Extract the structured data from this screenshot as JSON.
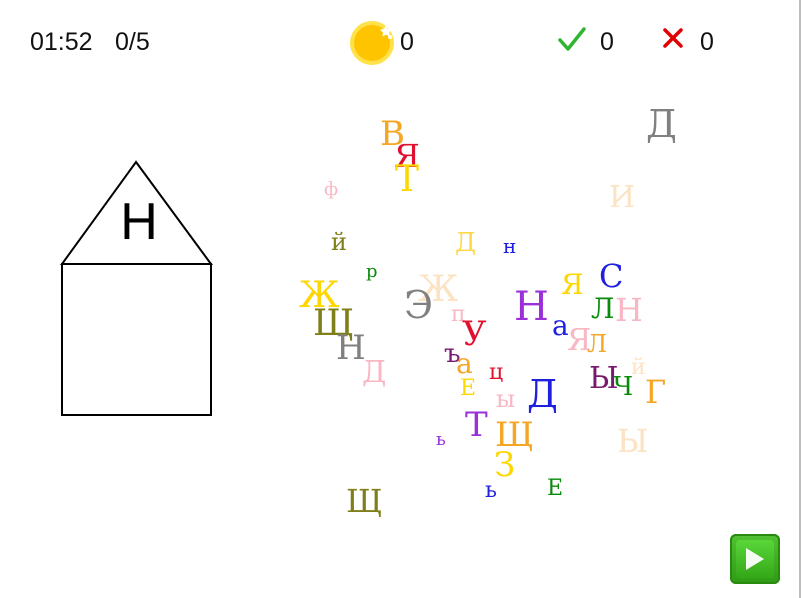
{
  "hud": {
    "timer": "01:52",
    "progress": "0/5",
    "coins": "0",
    "correct": "0",
    "wrong": "0",
    "icons": {
      "coin": "coin-star-icon",
      "correct": "checkmark-icon",
      "wrong": "cross-icon",
      "play": "play-icon"
    },
    "colors": {
      "coin": "#ffcc00",
      "correct": "#2fb52f",
      "wrong": "#e00000",
      "play": "#3fae1f"
    }
  },
  "house": {
    "letter": "Н"
  },
  "letters": [
    {
      "char": "В",
      "color": "#f5a623"
    },
    {
      "char": "Я",
      "color": "#e0102e"
    },
    {
      "char": "Т",
      "color": "#ffd700"
    },
    {
      "char": "Д",
      "color": "#808080"
    },
    {
      "char": "ф",
      "color": "#f8b7c3"
    },
    {
      "char": "И",
      "color": "#fbe3c4"
    },
    {
      "char": "й",
      "color": "#7f7f1a"
    },
    {
      "char": "Д",
      "color": "#ffd84a"
    },
    {
      "char": "н",
      "color": "#1f1fe0"
    },
    {
      "char": "р",
      "color": "#0a8a0a"
    },
    {
      "char": "Я",
      "color": "#ffd700"
    },
    {
      "char": "С",
      "color": "#1f1fe0"
    },
    {
      "char": "Ж",
      "color": "#ffd700"
    },
    {
      "char": "Ж",
      "color": "#fbe3c4"
    },
    {
      "char": "Э",
      "color": "#808080"
    },
    {
      "char": "Н",
      "color": "#9b30d9"
    },
    {
      "char": "Л",
      "color": "#0a8a0a"
    },
    {
      "char": "Н",
      "color": "#f8b7c3"
    },
    {
      "char": "Щ",
      "color": "#7f7f1a"
    },
    {
      "char": "п",
      "color": "#f8b7c3"
    },
    {
      "char": "У",
      "color": "#e0102e"
    },
    {
      "char": "а",
      "color": "#1f1fe0"
    },
    {
      "char": "Я",
      "color": "#f8b7c3"
    },
    {
      "char": "Л",
      "color": "#f5a623"
    },
    {
      "char": "Н",
      "color": "#808080"
    },
    {
      "char": "ъ",
      "color": "#7a1a6e"
    },
    {
      "char": "а",
      "color": "#f5a623"
    },
    {
      "char": "Д",
      "color": "#f8b7c3"
    },
    {
      "char": "ц",
      "color": "#e0102e"
    },
    {
      "char": "Е",
      "color": "#ffd700"
    },
    {
      "char": "Д",
      "color": "#1f1fe0"
    },
    {
      "char": "Ы",
      "color": "#7a1a6e"
    },
    {
      "char": "Ч",
      "color": "#0a8a0a"
    },
    {
      "char": "й",
      "color": "#fbe3c4"
    },
    {
      "char": "Г",
      "color": "#f5a623"
    },
    {
      "char": "ы",
      "color": "#f8b7c3"
    },
    {
      "char": "Т",
      "color": "#9b30d9"
    },
    {
      "char": "Щ",
      "color": "#f5a623"
    },
    {
      "char": "ь",
      "color": "#9b30d9"
    },
    {
      "char": "Ы",
      "color": "#fbe3c4"
    },
    {
      "char": "З",
      "color": "#ffd700"
    },
    {
      "char": "ь",
      "color": "#1f1fe0"
    },
    {
      "char": "Е",
      "color": "#0a8a0a"
    },
    {
      "char": "Щ",
      "color": "#7f7f1a"
    }
  ]
}
